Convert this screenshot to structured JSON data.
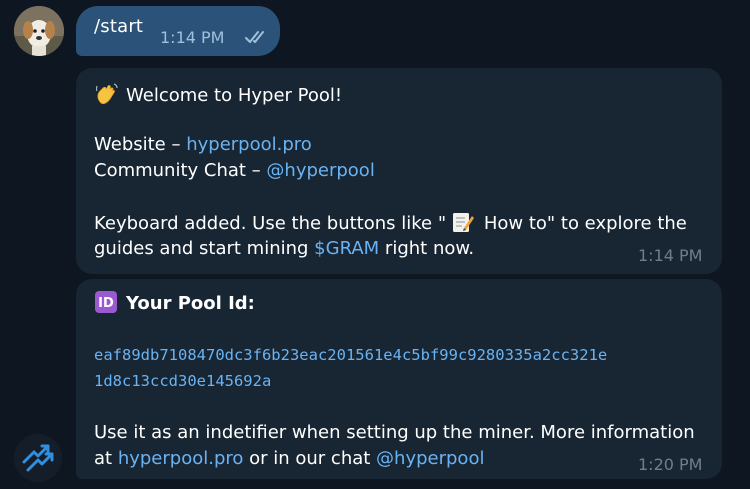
{
  "outgoing": {
    "text": "/start",
    "time": "1:14 PM"
  },
  "message1": {
    "welcome": "Welcome to Hyper Pool!",
    "website_label": "Website – ",
    "website_link": "hyperpool.pro",
    "community_label": "Community Chat – ",
    "community_link": "@hyperpool",
    "keyboard_part1": "Keyboard added. Use the buttons like \"",
    "keyboard_part2": " How to\" to explore the",
    "guides_part1": "guides and start mining ",
    "gram_link": "$GRAM",
    "guides_part2": " right now.",
    "time": "1:14 PM"
  },
  "message2": {
    "title": "Your Pool Id:",
    "pool_id_line1": "eaf89db7108470dc3f6b23eac201561e4c5bf99c9280335a2cc321e",
    "pool_id_line2": "1d8c13ccd30e145692a",
    "info_line1": "Use it as an indetifier when setting up the miner. More information",
    "info_at": "at ",
    "info_link1": "hyperpool.pro",
    "info_mid": " or in our chat ",
    "info_link2": "@hyperpool",
    "time": "1:20 PM"
  },
  "icons": {
    "user_avatar": "dog-avatar",
    "read_status": "double-check-icon",
    "wave": "waving-hand-icon",
    "memo": "memo-icon",
    "id": "id-button-icon",
    "bot_avatar": "hyper-pool-logo"
  },
  "colors": {
    "background": "#0e1621",
    "incoming_bubble": "#182533",
    "outgoing_bubble": "#2b5278",
    "link": "#6ab3f3",
    "time_incoming": "#6d7f8f",
    "time_outgoing": "#9fc1df"
  }
}
